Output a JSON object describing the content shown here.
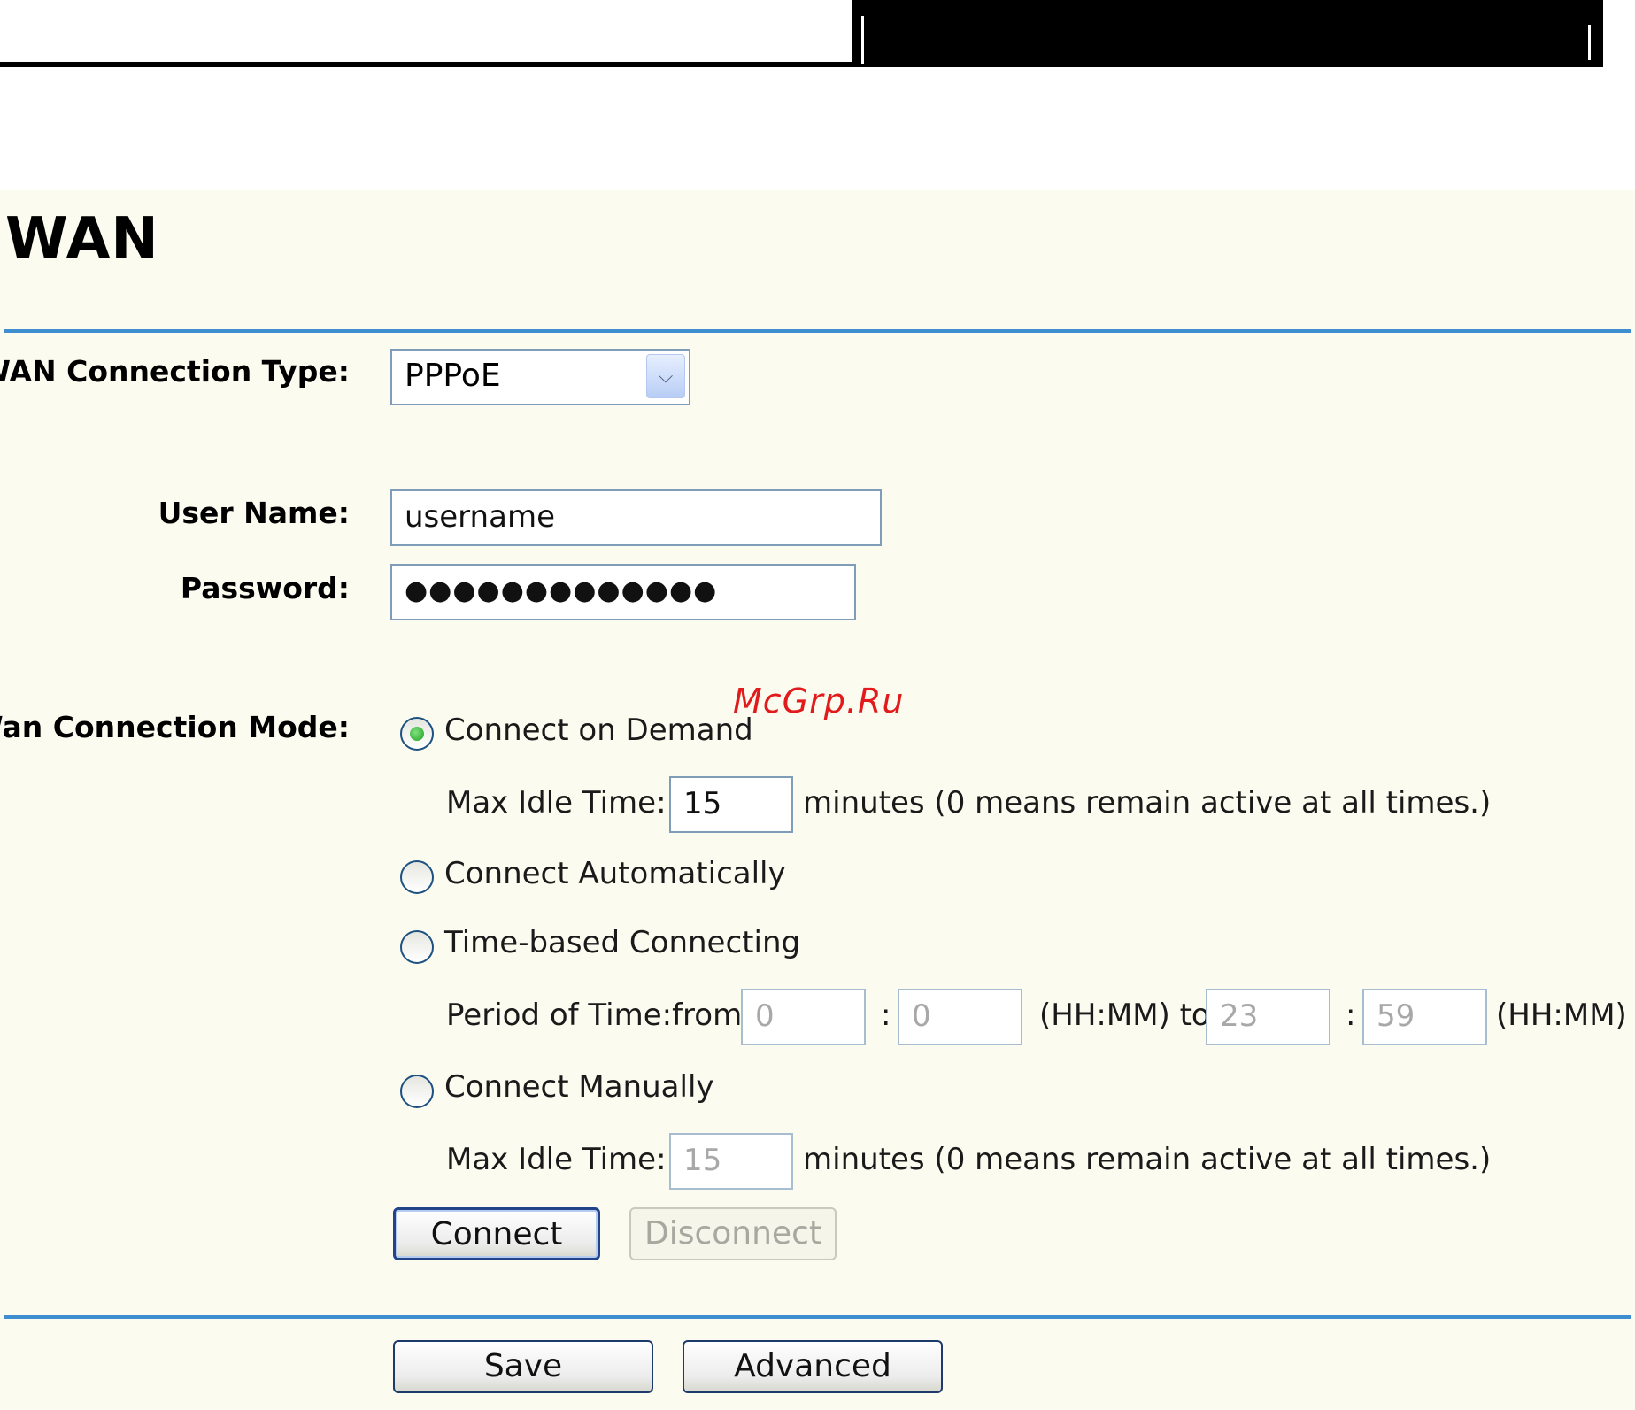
{
  "page_title": "WAN",
  "connection_type": {
    "label": "WAN Connection Type:",
    "selected": "PPPoE"
  },
  "user_name": {
    "label": "User Name:",
    "value": "username"
  },
  "password": {
    "label": "Password:",
    "value": "●●●●●●●●●●●●●"
  },
  "connection_mode": {
    "label": "Wan Connection Mode:",
    "on_demand": {
      "label": "Connect on Demand",
      "checked": true,
      "idle_label": "Max Idle Time:",
      "idle_value": "15",
      "idle_note": "minutes (0 means remain active at all times.)"
    },
    "automatic": {
      "label": "Connect Automatically",
      "checked": false
    },
    "time_based": {
      "label": "Time-based Connecting",
      "checked": false,
      "period_label": "Period of Time:from",
      "from_hh": "0",
      "from_mm": "0",
      "sep1": ":",
      "to_label": "(HH:MM) to",
      "to_hh": "23",
      "to_mm": "59",
      "sep2": ":",
      "end_label": "(HH:MM)"
    },
    "manual": {
      "label": "Connect Manually",
      "checked": false,
      "idle_label": "Max Idle Time:",
      "idle_value": "15",
      "idle_note": "minutes (0 means remain active at all times.)"
    }
  },
  "buttons": {
    "connect": "Connect",
    "disconnect": "Disconnect",
    "save": "Save",
    "advanced": "Advanced"
  },
  "watermark": "McGrp.Ru",
  "colors": {
    "panel_bg": "#fbfbf0",
    "divider": "#3f8fd0",
    "field_border": "#7f9db9",
    "watermark": "#e11b1b"
  }
}
